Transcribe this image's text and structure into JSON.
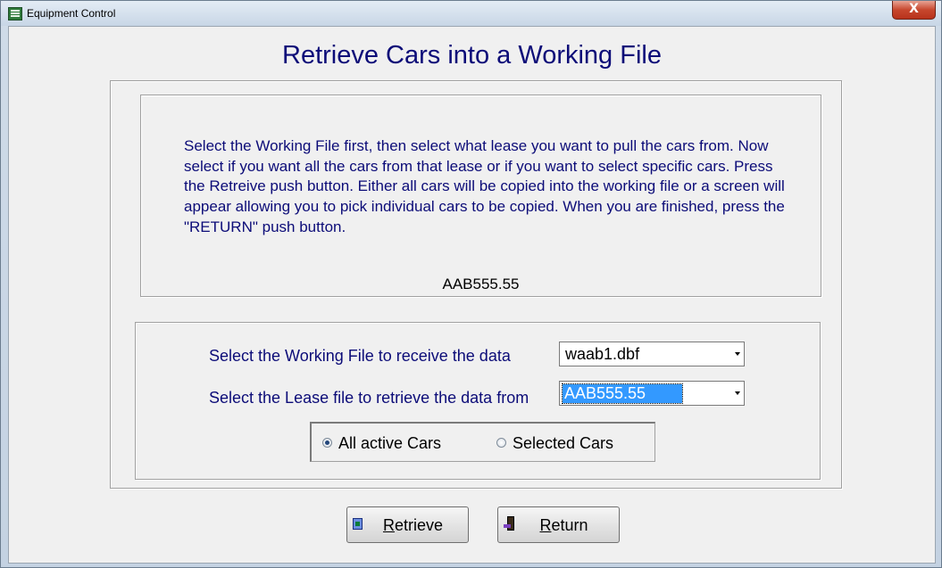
{
  "window": {
    "title": "Equipment Control",
    "close_label": "X"
  },
  "heading": "Retrieve Cars into a Working File",
  "instructions": "Select the Working File first, then select what lease you want to pull the cars from.  Now select if you want all the cars from that lease or if you want to select specific cars.  Press the Retreive push button.  Either all cars will be copied into the working file or a screen will appear allowing you to pick individual cars to be copied.  When you are finished, press the \"RETURN\" push button.",
  "current_lease": "AAB555.55",
  "form": {
    "working_file_label": "Select the Working File to receive the data",
    "working_file_value": "waab1.dbf",
    "lease_file_label": "Select the Lease file to retrieve the data from",
    "lease_file_value": "AAB555.55"
  },
  "radios": {
    "all_label": "All active Cars",
    "selected_label": "Selected Cars",
    "checked": "all"
  },
  "buttons": {
    "retrieve_label": "etrieve",
    "retrieve_hotkey": "R",
    "return_label": "eturn",
    "return_hotkey": "R"
  }
}
